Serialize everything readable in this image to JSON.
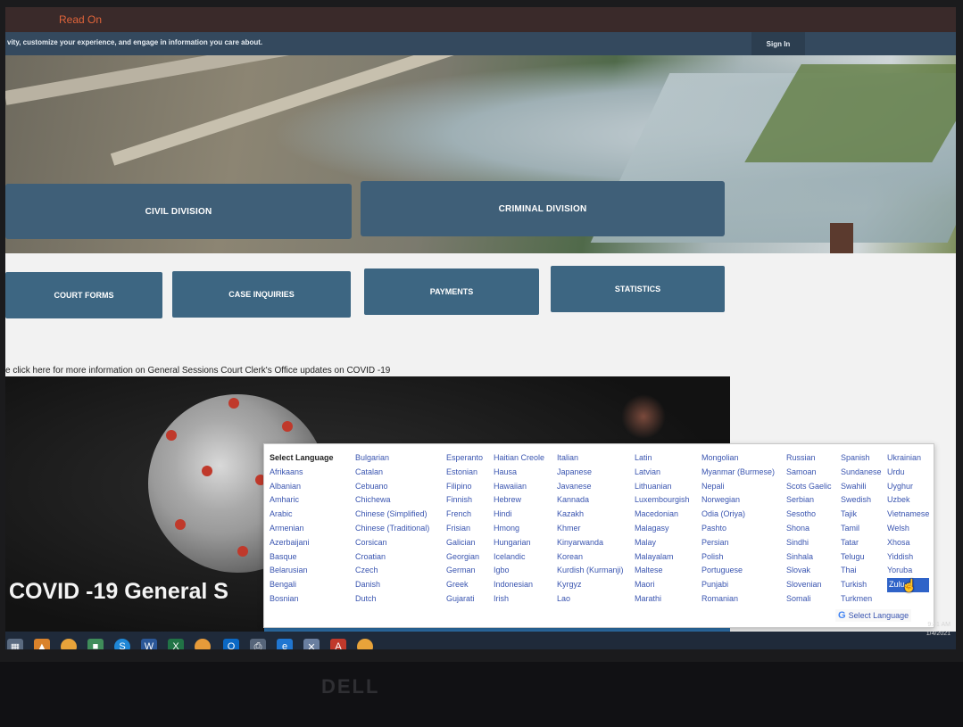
{
  "header": {
    "read_on": "Read On",
    "notice": "vity, customize your experience, and engage in information you care about.",
    "sign_in": "Sign In"
  },
  "divisions": {
    "civil": "CIVIL DIVISION",
    "criminal": "CRIMINAL DIVISION"
  },
  "nav": {
    "court_forms": "COURT FORMS",
    "case_inquiries": "CASE INQUIRIES",
    "payments": "PAYMENTS",
    "statistics": "STATISTICS"
  },
  "covid": {
    "link": "e click here for more information on General Sessions Court Clerk's Office updates on COVID -19",
    "banner_title": "COVID -19 General S"
  },
  "language_menu": {
    "columns": [
      [
        "Select Language",
        "Afrikaans",
        "Albanian",
        "Amharic",
        "Arabic",
        "Armenian",
        "Azerbaijani",
        "Basque",
        "Belarusian",
        "Bengali",
        "Bosnian"
      ],
      [
        "Bulgarian",
        "Catalan",
        "Cebuano",
        "Chichewa",
        "Chinese (Simplified)",
        "Chinese (Traditional)",
        "Corsican",
        "Croatian",
        "Czech",
        "Danish",
        "Dutch"
      ],
      [
        "Esperanto",
        "Estonian",
        "Filipino",
        "Finnish",
        "French",
        "Frisian",
        "Galician",
        "Georgian",
        "German",
        "Greek",
        "Gujarati"
      ],
      [
        "Haitian Creole",
        "Hausa",
        "Hawaiian",
        "Hebrew",
        "Hindi",
        "Hmong",
        "Hungarian",
        "Icelandic",
        "Igbo",
        "Indonesian",
        "Irish"
      ],
      [
        "Italian",
        "Japanese",
        "Javanese",
        "Kannada",
        "Kazakh",
        "Khmer",
        "Kinyarwanda",
        "Korean",
        "Kurdish (Kurmanji)",
        "Kyrgyz",
        "Lao"
      ],
      [
        "Latin",
        "Latvian",
        "Lithuanian",
        "Luxembourgish",
        "Macedonian",
        "Malagasy",
        "Malay",
        "Malayalam",
        "Maltese",
        "Maori",
        "Marathi"
      ],
      [
        "Mongolian",
        "Myanmar (Burmese)",
        "Nepali",
        "Norwegian",
        "Odia (Oriya)",
        "Pashto",
        "Persian",
        "Polish",
        "Portuguese",
        "Punjabi",
        "Romanian"
      ],
      [
        "Russian",
        "Samoan",
        "Scots Gaelic",
        "Serbian",
        "Sesotho",
        "Shona",
        "Sindhi",
        "Sinhala",
        "Slovak",
        "Slovenian",
        "Somali"
      ],
      [
        "Spanish",
        "Sundanese",
        "Swahili",
        "Swedish",
        "Tajik",
        "Tamil",
        "Tatar",
        "Telugu",
        "Thai",
        "Turkish",
        "Turkmen"
      ],
      [
        "Ukrainian",
        "Urdu",
        "Uyghur",
        "Uzbek",
        "Vietnamese",
        "Welsh",
        "Xhosa",
        "Yiddish",
        "Yoruba",
        "Zulu"
      ]
    ],
    "selected": "Zulu",
    "widget_label": "Select Language"
  },
  "taskbar": {
    "time": "9:41 AM",
    "date": "1/4/2021"
  },
  "monitor": {
    "brand": "DELL"
  }
}
